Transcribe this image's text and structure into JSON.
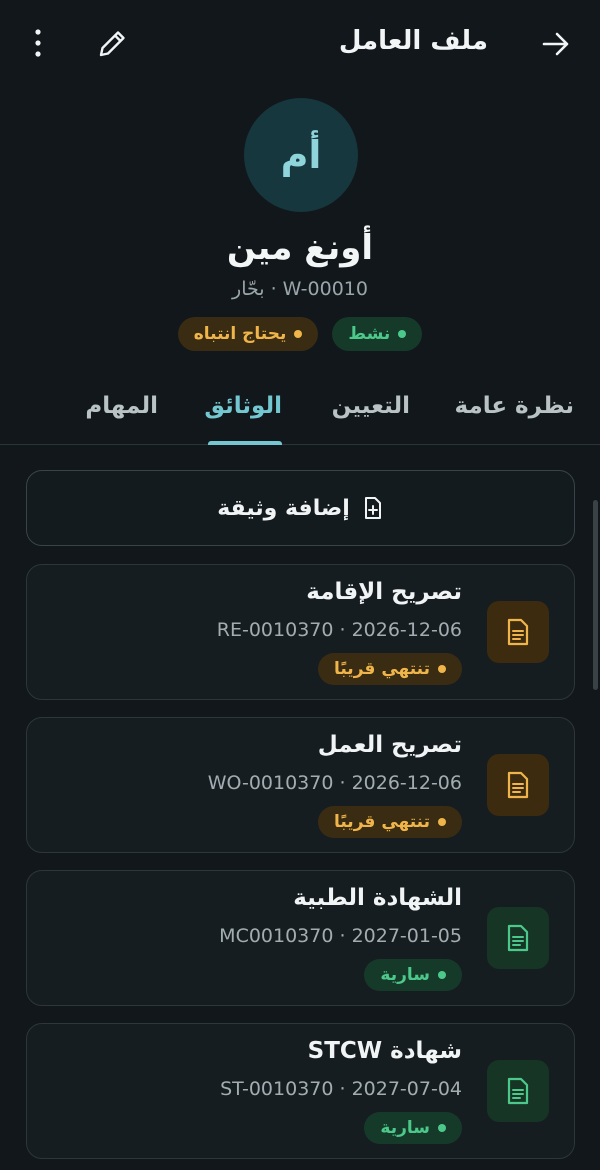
{
  "header": {
    "title": "ملف العامل",
    "back_icon": "arrow-right-icon",
    "edit_icon": "pencil-icon",
    "more_icon": "more-vertical-icon"
  },
  "profile": {
    "initials": "أم",
    "name": "أونغ مين",
    "subline": "W-00010 · بحّار",
    "badges": [
      {
        "label": "نشط",
        "tone": "green"
      },
      {
        "label": "يحتاج انتباه",
        "tone": "amber"
      }
    ]
  },
  "tabs": [
    {
      "label": "نظرة عامة",
      "active": false
    },
    {
      "label": "التعيين",
      "active": false
    },
    {
      "label": "الوثائق",
      "active": true
    },
    {
      "label": "المهام",
      "active": false
    }
  ],
  "add_document": {
    "label": "إضافة وثيقة",
    "icon": "file-plus-icon"
  },
  "documents": [
    {
      "title": "تصريح الإقامة",
      "meta": "RE-0010370 · 2026-12-06",
      "status": "تنتهي قريبًا",
      "tone": "amber"
    },
    {
      "title": "تصريح العمل",
      "meta": "WO-0010370 · 2026-12-06",
      "status": "تنتهي قريبًا",
      "tone": "amber"
    },
    {
      "title": "الشهادة الطبية",
      "meta": "MC0010370 · 2027-01-05",
      "status": "سارية",
      "tone": "green"
    },
    {
      "title": "شهادة STCW",
      "meta": "ST-0010370 · 2027-07-04",
      "status": "سارية",
      "tone": "green"
    }
  ],
  "colors": {
    "background": "#11171a",
    "accent": "#74c7d0",
    "amber": "#f0b54a",
    "green": "#4cc98a"
  }
}
